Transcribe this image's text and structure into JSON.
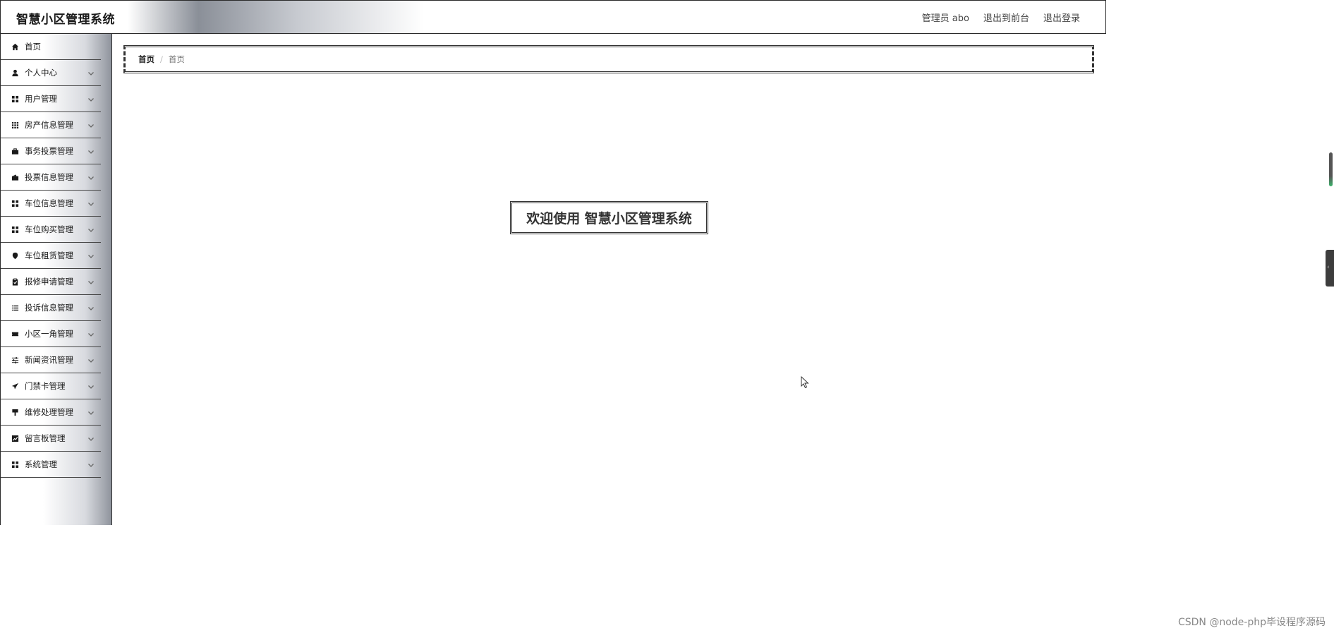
{
  "header": {
    "title": "智慧小区管理系统",
    "user_label": "管理员 abo",
    "to_front_label": "退出到前台",
    "logout_label": "退出登录"
  },
  "sidebar": {
    "items": [
      {
        "label": "首页",
        "icon": "home-icon",
        "has_submenu": false
      },
      {
        "label": "个人中心",
        "icon": "user-icon",
        "has_submenu": true
      },
      {
        "label": "用户管理",
        "icon": "grid-icon",
        "has_submenu": true
      },
      {
        "label": "房产信息管理",
        "icon": "apps-icon",
        "has_submenu": true
      },
      {
        "label": "事务投票管理",
        "icon": "briefcase-icon",
        "has_submenu": true
      },
      {
        "label": "投票信息管理",
        "icon": "wallet-icon",
        "has_submenu": true
      },
      {
        "label": "车位信息管理",
        "icon": "grid-icon",
        "has_submenu": true
      },
      {
        "label": "车位购买管理",
        "icon": "grid-icon",
        "has_submenu": true
      },
      {
        "label": "车位租赁管理",
        "icon": "pin-icon",
        "has_submenu": true
      },
      {
        "label": "报修申请管理",
        "icon": "clipboard-icon",
        "has_submenu": true
      },
      {
        "label": "投诉信息管理",
        "icon": "list-icon",
        "has_submenu": true
      },
      {
        "label": "小区一角管理",
        "icon": "ticket-icon",
        "has_submenu": true
      },
      {
        "label": "新闻资讯管理",
        "icon": "sliders-icon",
        "has_submenu": true
      },
      {
        "label": "门禁卡管理",
        "icon": "send-icon",
        "has_submenu": true
      },
      {
        "label": "维修处理管理",
        "icon": "brush-icon",
        "has_submenu": true
      },
      {
        "label": "留言板管理",
        "icon": "chart-icon",
        "has_submenu": true
      },
      {
        "label": "系统管理",
        "icon": "grid-icon",
        "has_submenu": true
      }
    ]
  },
  "breadcrumb": {
    "home": "首页",
    "separator": "/",
    "current": "首页"
  },
  "welcome": {
    "text": "欢迎使用 智慧小区管理系统"
  },
  "watermark": "CSDN @node-php毕设程序源码"
}
